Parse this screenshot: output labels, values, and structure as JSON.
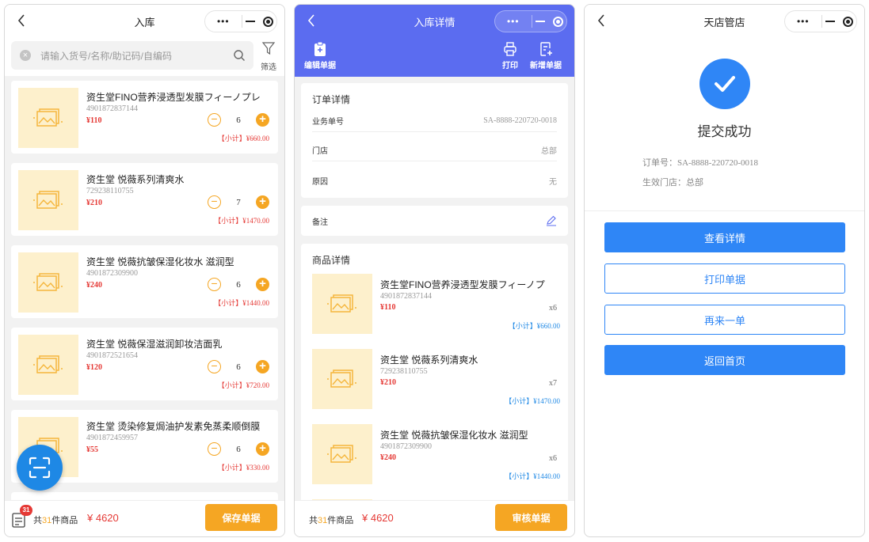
{
  "colors": {
    "brand_blue": "#2f86f6",
    "header_purple": "#5b6cf0",
    "accent_orange": "#f5a623",
    "price_red": "#e53935"
  },
  "screen1": {
    "title": "入库",
    "search_placeholder": "请输入货号/名称/助记码/自编码",
    "filter_label": "筛选",
    "products": [
      {
        "name": "资生堂FINO营养浸透型发膜フィーノプレ",
        "code": "4901872837144",
        "price": "¥110",
        "qty": "6",
        "subtotal": "【小计】¥660.00"
      },
      {
        "name": "资生堂 悦薇系列清爽水",
        "code": "729238110755",
        "price": "¥210",
        "qty": "7",
        "subtotal": "【小计】¥1470.00"
      },
      {
        "name": "资生堂 悦薇抗皱保湿化妆水 滋润型",
        "code": "4901872309900",
        "price": "¥240",
        "qty": "6",
        "subtotal": "【小计】¥1440.00"
      },
      {
        "name": "资生堂 悦薇保湿滋润卸妆洁面乳",
        "code": "4901872521654",
        "price": "¥120",
        "qty": "6",
        "subtotal": "【小计】¥720.00"
      },
      {
        "name": "资生堂 烫染修复焗油护发素免蒸柔顺倒膜",
        "code": "4901872459957",
        "price": "¥55",
        "qty": "6",
        "subtotal": "【小计】¥330.00"
      }
    ],
    "badge_count": "31",
    "total_prefix": "共",
    "total_count": "31",
    "total_suffix": "件商品",
    "total_amount": "¥ 4620",
    "save_label": "保存单据"
  },
  "screen2": {
    "title": "入库详情",
    "edit_label": "编辑单据",
    "print_label": "打印",
    "new_label": "新增单据",
    "order_header": "订单详情",
    "order_no_label": "业务单号",
    "order_no": "SA-8888-220720-0018",
    "store_label": "门店",
    "store_value": "总部",
    "reason_label": "原因",
    "reason_value": "无",
    "remark_label": "备注",
    "goods_header": "商品详情",
    "items": [
      {
        "name": "资生堂FINO营养浸透型发膜フィーノプ",
        "code": "4901872837144",
        "price": "¥110",
        "qty": "x6",
        "subtotal": "【小计】¥660.00"
      },
      {
        "name": "资生堂 悦薇系列清爽水",
        "code": "729238110755",
        "price": "¥210",
        "qty": "x7",
        "subtotal": "【小计】¥1470.00"
      },
      {
        "name": "资生堂 悦薇抗皱保湿化妆水 滋润型",
        "code": "4901872309900",
        "price": "¥240",
        "qty": "x6",
        "subtotal": "【小计】¥1440.00"
      }
    ],
    "total_prefix": "共",
    "total_count": "31",
    "total_suffix": "件商品",
    "total_amount": "¥ 4620",
    "audit_label": "审核单据"
  },
  "screen3": {
    "title": "天店管店",
    "success_text": "提交成功",
    "order_line": "订单号：SA-8888-220720-0018",
    "store_line": "生效门店：总部",
    "btn_detail": "查看详情",
    "btn_print": "打印单据",
    "btn_again": "再来一单",
    "btn_home": "返回首页"
  }
}
